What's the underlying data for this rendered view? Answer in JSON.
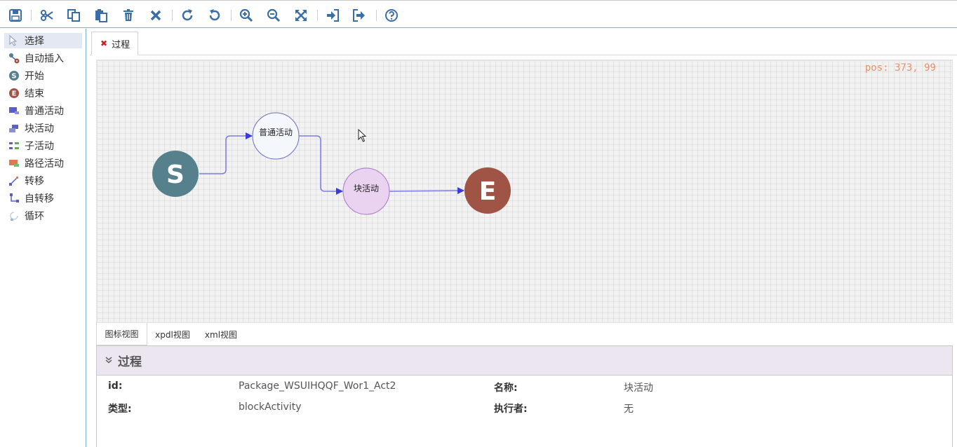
{
  "toolbar": {
    "buttons": [
      {
        "name": "save-icon"
      },
      {
        "name": "cut-icon"
      },
      {
        "name": "copy-icon"
      },
      {
        "name": "paste-icon"
      },
      {
        "name": "delete-icon"
      },
      {
        "name": "close-icon"
      },
      {
        "name": "redo-icon"
      },
      {
        "name": "undo-icon"
      },
      {
        "name": "zoom-in-icon"
      },
      {
        "name": "zoom-out-icon"
      },
      {
        "name": "fit-screen-icon"
      },
      {
        "name": "import-icon"
      },
      {
        "name": "export-icon"
      },
      {
        "name": "help-icon"
      }
    ],
    "icon_color": "#3b6ea5"
  },
  "palette": {
    "items": [
      {
        "label": "选择",
        "icon": "pointer-icon",
        "selected": true
      },
      {
        "label": "自动插入",
        "icon": "auto-insert-icon"
      },
      {
        "label": "开始",
        "icon": "start-node-icon"
      },
      {
        "label": "结束",
        "icon": "end-node-icon"
      },
      {
        "label": "普通活动",
        "icon": "normal-activity-icon"
      },
      {
        "label": "块活动",
        "icon": "block-activity-icon"
      },
      {
        "label": "子活动",
        "icon": "sub-activity-icon"
      },
      {
        "label": "路径活动",
        "icon": "route-activity-icon"
      },
      {
        "label": "转移",
        "icon": "transition-icon"
      },
      {
        "label": "自转移",
        "icon": "self-transition-icon"
      },
      {
        "label": "循环",
        "icon": "loop-icon"
      }
    ]
  },
  "tabs": {
    "doc_tab": {
      "label": "过程",
      "close": "✖"
    }
  },
  "canvas": {
    "pos_label": "pos: 373, 99",
    "nodes": {
      "start": {
        "label": "S",
        "color": "#55808c"
      },
      "normal": {
        "label": "普通活动",
        "fill": "#f4f8fc",
        "stroke": "#6d6fbe"
      },
      "block": {
        "label": "块活动",
        "fill": "#ead3f0",
        "stroke": "#a678c8"
      },
      "end": {
        "label": "E",
        "color": "#a05446"
      }
    },
    "edge_color": "#7a7ae6",
    "arrow_color": "#3a3ad8"
  },
  "view_tabs": [
    {
      "label": "图标视图",
      "active": true
    },
    {
      "label": "xpdl视图"
    },
    {
      "label": "xml视图"
    }
  ],
  "properties": {
    "title": "过程",
    "id_label": "id:",
    "id_value": "Package_WSUIHQQF_Wor1_Act2",
    "name_label": "名称:",
    "name_value": "块活动",
    "type_label": "类型:",
    "type_value": "blockActivity",
    "performer_label": "执行者:",
    "performer_value": "无"
  }
}
